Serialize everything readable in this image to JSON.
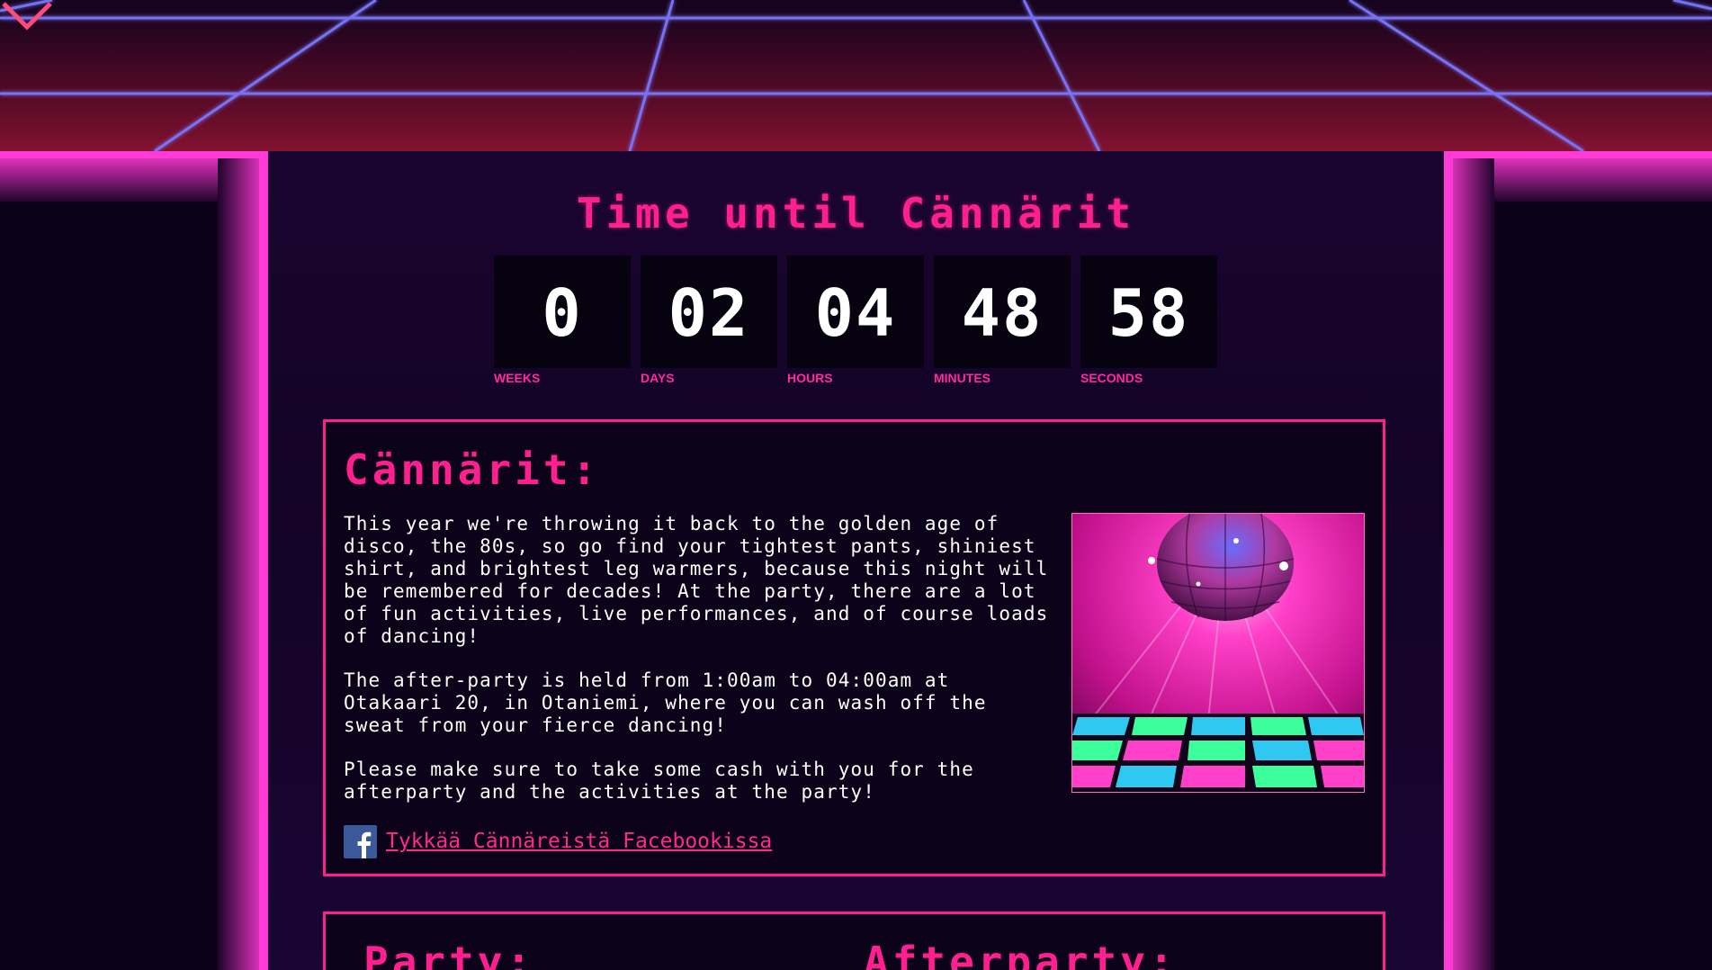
{
  "countdown": {
    "title": "Time until Cännärit",
    "units": [
      {
        "value": "0",
        "label": "WEEKS"
      },
      {
        "value": "02",
        "label": "DAYS"
      },
      {
        "value": "04",
        "label": "HOURS"
      },
      {
        "value": "48",
        "label": "MINUTES"
      },
      {
        "value": "58",
        "label": "SECONDS"
      }
    ]
  },
  "info": {
    "heading": "Cännärit:",
    "paragraphs": [
      "This year we're throwing it back to the golden age of disco, the 80s, so go find your tightest pants, shiniest shirt, and brightest leg warmers, because this night will be remembered for decades! At the party, there are a lot of fun activities, live performances, and of course loads of dancing!",
      "The after-party is held from 1:00am to 04:00am at Otakaari 20, in Otaniemi, where you can wash off the sweat from your fierce dancing!",
      "Please make sure to take some cash with you for the afterparty and the activities at the party!"
    ],
    "facebook_link": "Tykkää Cännäreistä Facebookissa"
  },
  "sections": {
    "party_heading": "Party:",
    "afterparty_heading": "Afterparty:"
  },
  "colors": {
    "neon_pink": "#ff1f8e",
    "grid_blue": "#6a6cff",
    "background": "#0c0318"
  },
  "icons": {
    "scroll": "chevron-down-icon",
    "social": "facebook-icon"
  }
}
